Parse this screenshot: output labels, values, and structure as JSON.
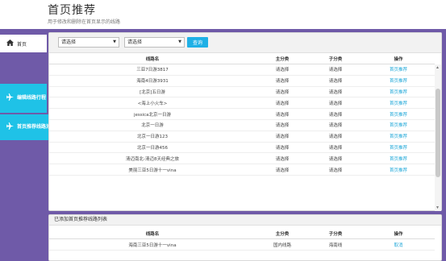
{
  "header": {
    "title": "首页推荐",
    "subtitle": "用于修改和删除在首页显示的线路"
  },
  "sidebar": {
    "items": [
      {
        "icon": "home-icon",
        "label": "首页"
      },
      {
        "icon": "plane-icon",
        "label": "编辑线路行程"
      },
      {
        "icon": "plane-icon",
        "label": "首页推荐线路添加"
      }
    ]
  },
  "filters": {
    "select1": "请选择",
    "select2": "请选择",
    "search_label": "查询"
  },
  "routes_table": {
    "headers": [
      "线路名",
      "主分类",
      "子分类",
      "操作"
    ],
    "rows": [
      {
        "name": "三亚7日游3817",
        "main": "请选择",
        "sub": "请选择",
        "action": "首页推荐"
      },
      {
        "name": "海南4日游3931",
        "main": "请选择",
        "sub": "请选择",
        "action": "首页推荐"
      },
      {
        "name": "[北京]五日游",
        "main": "请选择",
        "sub": "请选择",
        "action": "首页推荐"
      },
      {
        "name": "<海上小火车>",
        "main": "请选择",
        "sub": "请选择",
        "action": "首页推荐"
      },
      {
        "name": "jessica北京一日游",
        "main": "请选择",
        "sub": "请选择",
        "action": "首页推荐"
      },
      {
        "name": "北京一日游",
        "main": "请选择",
        "sub": "请选择",
        "action": "首页推荐"
      },
      {
        "name": "北京一日游123",
        "main": "请选择",
        "sub": "请选择",
        "action": "首页推荐"
      },
      {
        "name": "北京一日游456",
        "main": "请选择",
        "sub": "请选择",
        "action": "首页推荐"
      },
      {
        "name": "清迈南北-清迈8天经典之旅",
        "main": "请选择",
        "sub": "请选择",
        "action": "首页推荐"
      },
      {
        "name": "美丽三亚5日游十一vina",
        "main": "请选择",
        "sub": "请选择",
        "action": "首页推荐"
      }
    ]
  },
  "added_section": {
    "title": "已添加首页推荐线路列表",
    "headers": [
      "线路名",
      "主分类",
      "子分类",
      "操作"
    ],
    "rows": [
      {
        "name": "海南三亚5日游十一vina",
        "main": "国内线路",
        "sub": "海南线",
        "action": "取消"
      }
    ]
  }
}
